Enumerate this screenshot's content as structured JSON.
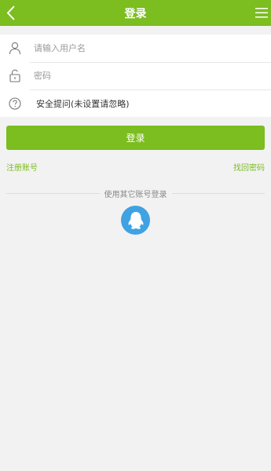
{
  "header": {
    "title": "登录",
    "back_icon": "chevron-left-icon",
    "menu_icon": "hamburger-icon"
  },
  "form": {
    "username_placeholder": "请输入用户名",
    "password_placeholder": "密码",
    "security_question": "安全提问(未设置请忽略)"
  },
  "login_button": "登录",
  "links": {
    "register": "注册账号",
    "recover": "找回密码"
  },
  "other_login": {
    "label": "使用其它账号登录",
    "qq_icon": "qq-icon"
  },
  "colors": {
    "accent": "#7cbd1f",
    "qq": "#3fa2e3",
    "background": "#f2f2f2"
  }
}
